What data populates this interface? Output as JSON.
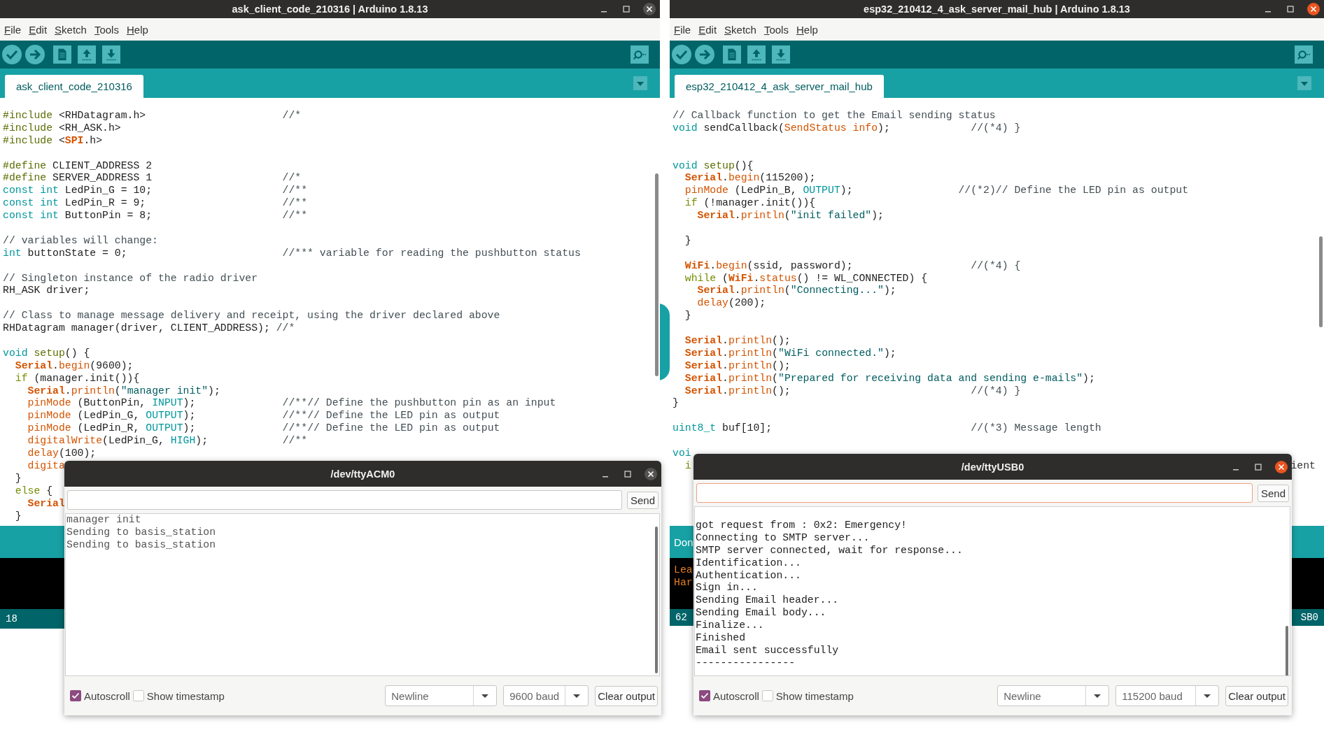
{
  "ide_windows": [
    {
      "title": "ask_client_code_210316 | Arduino 1.8.13",
      "menu": [
        "File",
        "Edit",
        "Sketch",
        "Tools",
        "Help"
      ],
      "tabs": [
        {
          "label": "ask_client_code_210316",
          "selected": true
        }
      ],
      "code_lines": [
        {
          "kind": "code",
          "spans": [
            {
              "kind": "pp",
              "text": "#include"
            },
            {
              "kind": "p",
              "text": " <RHDatagram.h>                      "
            },
            {
              "kind": "cm",
              "text": "//*"
            }
          ]
        },
        {
          "kind": "code",
          "spans": [
            {
              "kind": "pp",
              "text": "#include"
            },
            {
              "kind": "p",
              "text": " <RH_ASK.h>"
            }
          ]
        },
        {
          "kind": "code",
          "spans": [
            {
              "kind": "pp",
              "text": "#include"
            },
            {
              "kind": "p",
              "text": " <"
            },
            {
              "kind": "obj",
              "text": "SPI"
            },
            {
              "kind": "p",
              "text": ".h>"
            }
          ]
        },
        {
          "kind": "blank"
        },
        {
          "kind": "code",
          "spans": [
            {
              "kind": "pp",
              "text": "#define"
            },
            {
              "kind": "p",
              "text": " CLIENT_ADDRESS 2"
            }
          ]
        },
        {
          "kind": "code",
          "spans": [
            {
              "kind": "pp",
              "text": "#define"
            },
            {
              "kind": "p",
              "text": " SERVER_ADDRESS 1                     "
            },
            {
              "kind": "cm",
              "text": "//*"
            }
          ]
        },
        {
          "kind": "code",
          "spans": [
            {
              "kind": "kw",
              "text": "const"
            },
            {
              "kind": "kw",
              "text": " int"
            },
            {
              "kind": "p",
              "text": " LedPin_G = 10;                     "
            },
            {
              "kind": "cm",
              "text": "//**"
            }
          ]
        },
        {
          "kind": "code",
          "spans": [
            {
              "kind": "kw",
              "text": "const"
            },
            {
              "kind": "kw",
              "text": " int"
            },
            {
              "kind": "p",
              "text": " LedPin_R = 9;                      "
            },
            {
              "kind": "cm",
              "text": "//**"
            }
          ]
        },
        {
          "kind": "code",
          "spans": [
            {
              "kind": "kw",
              "text": "const"
            },
            {
              "kind": "kw",
              "text": " int"
            },
            {
              "kind": "p",
              "text": " ButtonPin = 8;                     "
            },
            {
              "kind": "cm",
              "text": "//**"
            }
          ]
        },
        {
          "kind": "blank"
        },
        {
          "kind": "code",
          "spans": [
            {
              "kind": "cm",
              "text": "// variables will change:"
            }
          ]
        },
        {
          "kind": "code",
          "spans": [
            {
              "kind": "kw",
              "text": "int"
            },
            {
              "kind": "p",
              "text": " buttonState = 0;                         "
            },
            {
              "kind": "cm",
              "text": "//*** variable for reading the pushbutton status"
            }
          ]
        },
        {
          "kind": "blank"
        },
        {
          "kind": "code",
          "spans": [
            {
              "kind": "cm",
              "text": "// Singleton instance of the radio driver"
            }
          ]
        },
        {
          "kind": "code",
          "spans": [
            {
              "kind": "p",
              "text": "RH_ASK driver;"
            }
          ]
        },
        {
          "kind": "blank"
        },
        {
          "kind": "code",
          "spans": [
            {
              "kind": "cm",
              "text": "// Class to manage message delivery and receipt, using the driver declared above"
            }
          ]
        },
        {
          "kind": "code",
          "spans": [
            {
              "kind": "p",
              "text": "RHDatagram manager(driver, CLIENT_ADDRESS); "
            },
            {
              "kind": "cm",
              "text": "//*"
            }
          ]
        },
        {
          "kind": "blank"
        },
        {
          "kind": "code",
          "spans": [
            {
              "kind": "kw",
              "text": "void"
            },
            {
              "kind": "fn2",
              "text": " setup"
            },
            {
              "kind": "p",
              "text": "() {"
            }
          ]
        },
        {
          "kind": "code",
          "spans": [
            {
              "kind": "obj",
              "text": "  Serial"
            },
            {
              "kind": "p",
              "text": "."
            },
            {
              "kind": "m",
              "text": "begin"
            },
            {
              "kind": "p",
              "text": "(9600);"
            }
          ]
        },
        {
          "kind": "code",
          "spans": [
            {
              "kind": "ctl",
              "text": "  if"
            },
            {
              "kind": "p",
              "text": " (manager.init()){"
            }
          ]
        },
        {
          "kind": "code",
          "spans": [
            {
              "kind": "obj",
              "text": "    Serial"
            },
            {
              "kind": "p",
              "text": "."
            },
            {
              "kind": "m",
              "text": "println"
            },
            {
              "kind": "p",
              "text": "("
            },
            {
              "kind": "str",
              "text": "\"manager init\""
            },
            {
              "kind": "p",
              "text": ");"
            }
          ]
        },
        {
          "kind": "code",
          "spans": [
            {
              "kind": "m",
              "text": "    pinMode"
            },
            {
              "kind": "p",
              "text": " (ButtonPin, "
            },
            {
              "kind": "kw",
              "text": "INPUT"
            },
            {
              "kind": "p",
              "text": ");              "
            },
            {
              "kind": "cm",
              "text": "//**// Define the pushbutton pin as an input"
            }
          ]
        },
        {
          "kind": "code",
          "spans": [
            {
              "kind": "m",
              "text": "    pinMode"
            },
            {
              "kind": "p",
              "text": " (LedPin_G, "
            },
            {
              "kind": "kw",
              "text": "OUTPUT"
            },
            {
              "kind": "p",
              "text": ");              "
            },
            {
              "kind": "cm",
              "text": "//**// Define the LED pin as output"
            }
          ]
        },
        {
          "kind": "code",
          "spans": [
            {
              "kind": "m",
              "text": "    pinMode"
            },
            {
              "kind": "p",
              "text": " (LedPin_R, "
            },
            {
              "kind": "kw",
              "text": "OUTPUT"
            },
            {
              "kind": "p",
              "text": ");              "
            },
            {
              "kind": "cm",
              "text": "//**// Define the LED pin as output"
            }
          ]
        },
        {
          "kind": "code",
          "spans": [
            {
              "kind": "m",
              "text": "    digitalWrite"
            },
            {
              "kind": "p",
              "text": "(LedPin_G, "
            },
            {
              "kind": "kw",
              "text": "HIGH"
            },
            {
              "kind": "p",
              "text": ");            "
            },
            {
              "kind": "cm",
              "text": "//**"
            }
          ]
        },
        {
          "kind": "code",
          "spans": [
            {
              "kind": "m",
              "text": "    delay"
            },
            {
              "kind": "p",
              "text": "(100);"
            }
          ]
        },
        {
          "kind": "code",
          "spans": [
            {
              "kind": "m",
              "text": "    digita"
            }
          ]
        },
        {
          "kind": "code",
          "spans": [
            {
              "kind": "p",
              "text": "  }"
            }
          ]
        },
        {
          "kind": "code",
          "spans": [
            {
              "kind": "ctl",
              "text": "  else"
            },
            {
              "kind": "p",
              "text": " {"
            }
          ]
        },
        {
          "kind": "code",
          "spans": [
            {
              "kind": "obj",
              "text": "    Serial"
            }
          ]
        },
        {
          "kind": "code",
          "spans": [
            {
              "kind": "p",
              "text": "  }"
            }
          ]
        }
      ],
      "line_number": "18"
    },
    {
      "title": "esp32_210412_4_ask_server_mail_hub | Arduino 1.8.13",
      "menu": [
        "File",
        "Edit",
        "Sketch",
        "Tools",
        "Help"
      ],
      "tabs": [
        {
          "label": "esp32_210412_4_ask_server_mail_hub",
          "selected": true
        }
      ],
      "code_lines": [
        {
          "kind": "code",
          "spans": [
            {
              "kind": "cm",
              "text": "// Callback function to get the Email sending status"
            }
          ]
        },
        {
          "kind": "code",
          "spans": [
            {
              "kind": "kw",
              "text": "void"
            },
            {
              "kind": "p",
              "text": " sendCallback("
            },
            {
              "kind": "m",
              "text": "SendStatus info"
            },
            {
              "kind": "p",
              "text": ");             "
            },
            {
              "kind": "cm",
              "text": "//(*4) }"
            }
          ]
        },
        {
          "kind": "blank"
        },
        {
          "kind": "blank"
        },
        {
          "kind": "code",
          "spans": [
            {
              "kind": "kw",
              "text": "void"
            },
            {
              "kind": "fn2",
              "text": " setup"
            },
            {
              "kind": "p",
              "text": "(){"
            }
          ]
        },
        {
          "kind": "code",
          "spans": [
            {
              "kind": "obj",
              "text": "  Serial"
            },
            {
              "kind": "p",
              "text": "."
            },
            {
              "kind": "m",
              "text": "begin"
            },
            {
              "kind": "p",
              "text": "(115200);"
            }
          ]
        },
        {
          "kind": "code",
          "spans": [
            {
              "kind": "m",
              "text": "  pinMode"
            },
            {
              "kind": "p",
              "text": " (LedPin_B, "
            },
            {
              "kind": "kw",
              "text": "OUTPUT"
            },
            {
              "kind": "p",
              "text": ");                 "
            },
            {
              "kind": "cm",
              "text": "//(*2)// Define the LED pin as output"
            }
          ]
        },
        {
          "kind": "code",
          "spans": [
            {
              "kind": "ctl",
              "text": "  if"
            },
            {
              "kind": "p",
              "text": " (!manager.init()){"
            }
          ]
        },
        {
          "kind": "code",
          "spans": [
            {
              "kind": "obj",
              "text": "    Serial"
            },
            {
              "kind": "p",
              "text": "."
            },
            {
              "kind": "m",
              "text": "println"
            },
            {
              "kind": "p",
              "text": "("
            },
            {
              "kind": "str",
              "text": "\"init failed\""
            },
            {
              "kind": "p",
              "text": ");"
            }
          ]
        },
        {
          "kind": "blank"
        },
        {
          "kind": "code",
          "spans": [
            {
              "kind": "p",
              "text": "  }"
            }
          ]
        },
        {
          "kind": "blank"
        },
        {
          "kind": "code",
          "spans": [
            {
              "kind": "obj",
              "text": "  WiFi"
            },
            {
              "kind": "p",
              "text": "."
            },
            {
              "kind": "m",
              "text": "begin"
            },
            {
              "kind": "p",
              "text": "(ssid, password);                   "
            },
            {
              "kind": "cm",
              "text": "//(*4) {"
            }
          ]
        },
        {
          "kind": "code",
          "spans": [
            {
              "kind": "ctl",
              "text": "  while"
            },
            {
              "kind": "p",
              "text": " ("
            },
            {
              "kind": "obj",
              "text": "WiFi"
            },
            {
              "kind": "p",
              "text": "."
            },
            {
              "kind": "m",
              "text": "status"
            },
            {
              "kind": "p",
              "text": "() != WL_CONNECTED) {"
            }
          ]
        },
        {
          "kind": "code",
          "spans": [
            {
              "kind": "obj",
              "text": "    Serial"
            },
            {
              "kind": "p",
              "text": "."
            },
            {
              "kind": "m",
              "text": "println"
            },
            {
              "kind": "p",
              "text": "("
            },
            {
              "kind": "str",
              "text": "\"Connecting...\""
            },
            {
              "kind": "p",
              "text": ");"
            }
          ]
        },
        {
          "kind": "code",
          "spans": [
            {
              "kind": "m",
              "text": "    delay"
            },
            {
              "kind": "p",
              "text": "(200);"
            }
          ]
        },
        {
          "kind": "code",
          "spans": [
            {
              "kind": "p",
              "text": "  }"
            }
          ]
        },
        {
          "kind": "blank"
        },
        {
          "kind": "code",
          "spans": [
            {
              "kind": "obj",
              "text": "  Serial"
            },
            {
              "kind": "p",
              "text": "."
            },
            {
              "kind": "m",
              "text": "println"
            },
            {
              "kind": "p",
              "text": "();"
            }
          ]
        },
        {
          "kind": "code",
          "spans": [
            {
              "kind": "obj",
              "text": "  Serial"
            },
            {
              "kind": "p",
              "text": "."
            },
            {
              "kind": "m",
              "text": "println"
            },
            {
              "kind": "p",
              "text": "("
            },
            {
              "kind": "str",
              "text": "\"WiFi connected.\""
            },
            {
              "kind": "p",
              "text": ");"
            }
          ]
        },
        {
          "kind": "code",
          "spans": [
            {
              "kind": "obj",
              "text": "  Serial"
            },
            {
              "kind": "p",
              "text": "."
            },
            {
              "kind": "m",
              "text": "println"
            },
            {
              "kind": "p",
              "text": "();"
            }
          ]
        },
        {
          "kind": "code",
          "spans": [
            {
              "kind": "obj",
              "text": "  Serial"
            },
            {
              "kind": "p",
              "text": "."
            },
            {
              "kind": "m",
              "text": "println"
            },
            {
              "kind": "p",
              "text": "("
            },
            {
              "kind": "str",
              "text": "\"Prepared for receiving data and sending e-mails\""
            },
            {
              "kind": "p",
              "text": ");"
            }
          ]
        },
        {
          "kind": "code",
          "spans": [
            {
              "kind": "obj",
              "text": "  Serial"
            },
            {
              "kind": "p",
              "text": "."
            },
            {
              "kind": "m",
              "text": "println"
            },
            {
              "kind": "p",
              "text": "();                             "
            },
            {
              "kind": "cm",
              "text": "//(*4) }"
            }
          ]
        },
        {
          "kind": "code",
          "spans": [
            {
              "kind": "p",
              "text": "}"
            }
          ]
        },
        {
          "kind": "blank"
        },
        {
          "kind": "code",
          "spans": [
            {
              "kind": "kw",
              "text": "uint8_t"
            },
            {
              "kind": "p",
              "text": " buf[10];                                "
            },
            {
              "kind": "cm",
              "text": "//(*3) Message length"
            }
          ]
        },
        {
          "kind": "blank"
        },
        {
          "kind": "code",
          "spans": [
            {
              "kind": "kw",
              "text": "voi"
            }
          ]
        },
        {
          "kind": "code",
          "spans": [
            {
              "kind": "ctl",
              "text": "  i"
            },
            {
              "kind": "edge",
              "text": "ient"
            }
          ]
        }
      ],
      "status_text": "Don",
      "console_lines": [
        "Lea",
        "Har"
      ],
      "line_number": "62",
      "board_text": "SB0"
    }
  ],
  "serial_monitors": [
    {
      "title": "/dev/ttyACM0",
      "active": false,
      "send": "Send",
      "output_lines": [
        "manager init",
        "Sending to basis_station",
        "Sending to basis_station"
      ],
      "autoscroll": {
        "label": "Autoscroll",
        "checked": true
      },
      "show_timestamp": {
        "label": "Show timestamp",
        "checked": false
      },
      "line_ending": "Newline",
      "baud": "9600 baud",
      "clear": "Clear output"
    },
    {
      "title": "/dev/ttyUSB0",
      "active": true,
      "send": "Send",
      "output_lines": [
        "got request from : 0x2: Emergency!",
        "Connecting to SMTP server...",
        "SMTP server connected, wait for response...",
        "Identification...",
        "Authentication...",
        "Sign in...",
        "Sending Email header...",
        "Sending Email body...",
        "Finalize...",
        "Finished",
        "Email sent successfully",
        "----------------"
      ],
      "autoscroll": {
        "label": "Autoscroll",
        "checked": true
      },
      "show_timestamp": {
        "label": "Show timestamp",
        "checked": false
      },
      "line_ending": "Newline",
      "baud": "115200 baud",
      "clear": "Clear output"
    }
  ]
}
